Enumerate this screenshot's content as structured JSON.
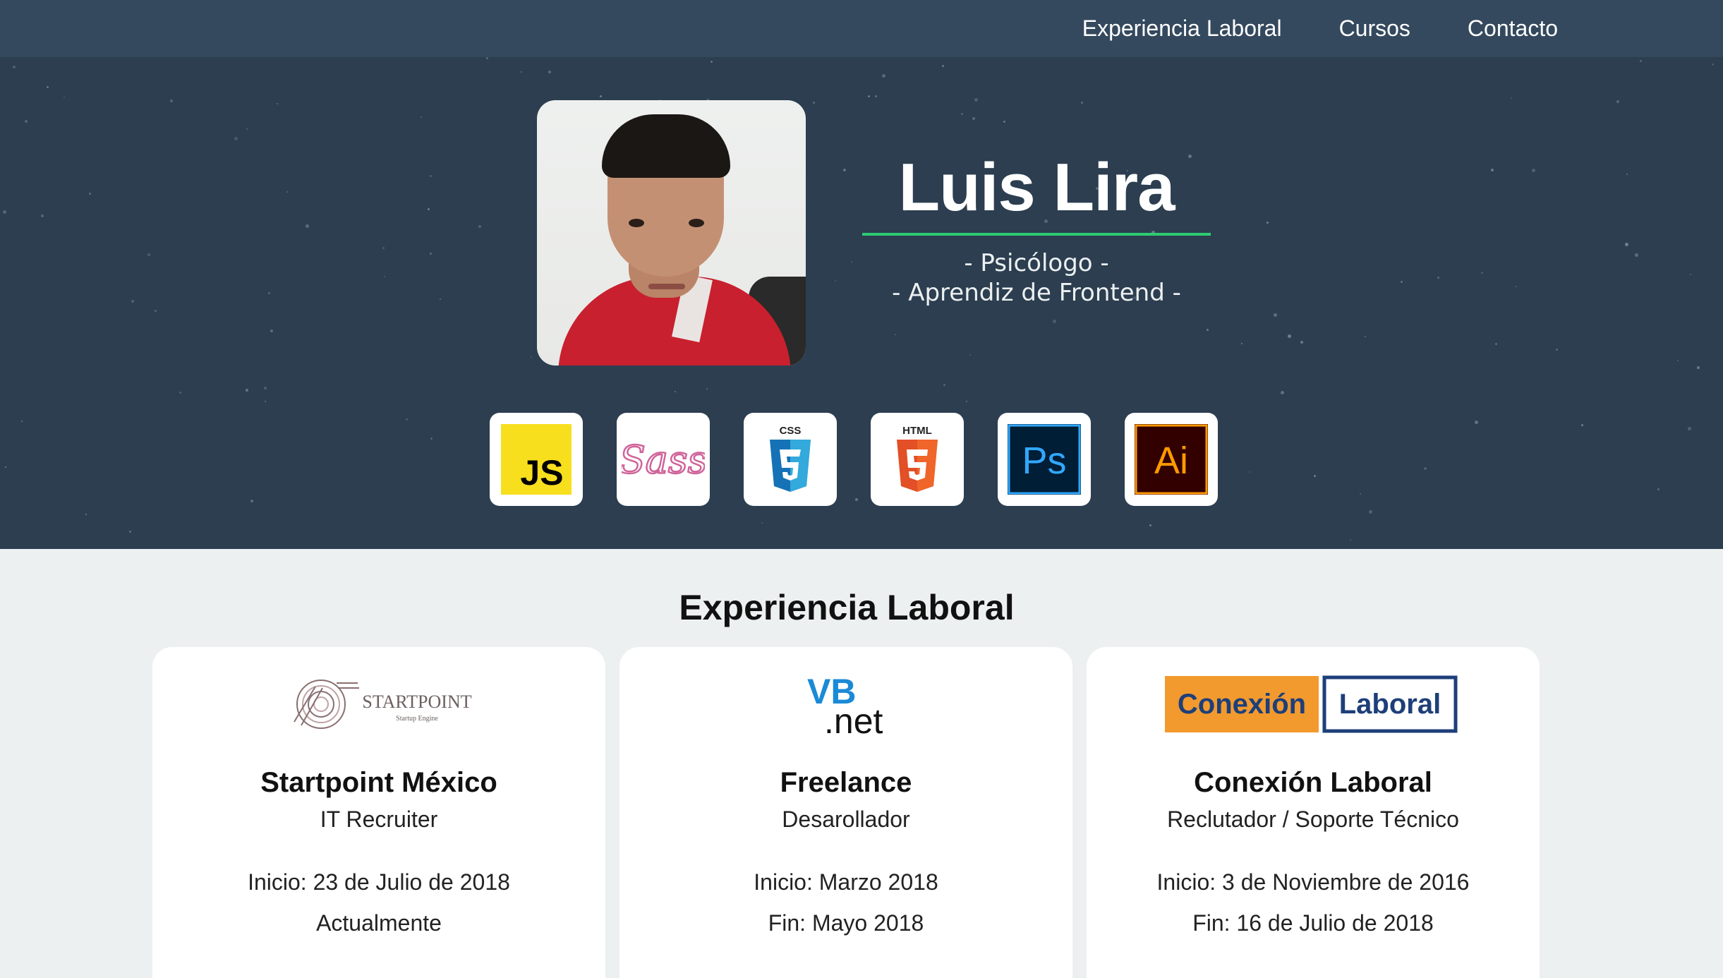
{
  "nav": {
    "items": [
      "Experiencia Laboral",
      "Cursos",
      "Contacto"
    ]
  },
  "hero": {
    "name": "Luis Lira",
    "subtitles": [
      "- Psicólogo -",
      "- Aprendiz de Frontend -"
    ],
    "accent_color": "#2ecc71",
    "background_color": "#2c3e50",
    "skills": [
      {
        "icon": "javascript-icon",
        "label": "JS"
      },
      {
        "icon": "sass-icon",
        "label": "Sass"
      },
      {
        "icon": "css3-icon",
        "label": "CSS"
      },
      {
        "icon": "html5-icon",
        "label": "HTML"
      },
      {
        "icon": "photoshop-icon",
        "label": "Ps"
      },
      {
        "icon": "illustrator-icon",
        "label": "Ai"
      }
    ]
  },
  "experience": {
    "title": "Experiencia Laboral",
    "cards": [
      {
        "logo_text": "STARTPOINT",
        "logo_subtext": "Startup Engine",
        "company": "Startpoint México",
        "role": "IT Recruiter",
        "start": "Inicio: 23 de Julio de 2018",
        "end": "Actualmente"
      },
      {
        "logo_text": "VB",
        "logo_subtext": ".net",
        "company": "Freelance",
        "role": "Desarollador",
        "start": "Inicio: Marzo 2018",
        "end": "Fin: Mayo 2018"
      },
      {
        "logo_text": "Conexión",
        "logo_subtext": "Laboral",
        "company": "Conexión Laboral",
        "role": "Reclutador / Soporte Técnico",
        "start": "Inicio: 3 de Noviembre de 2016",
        "end": "Fin: 16 de Julio de 2018"
      }
    ]
  }
}
